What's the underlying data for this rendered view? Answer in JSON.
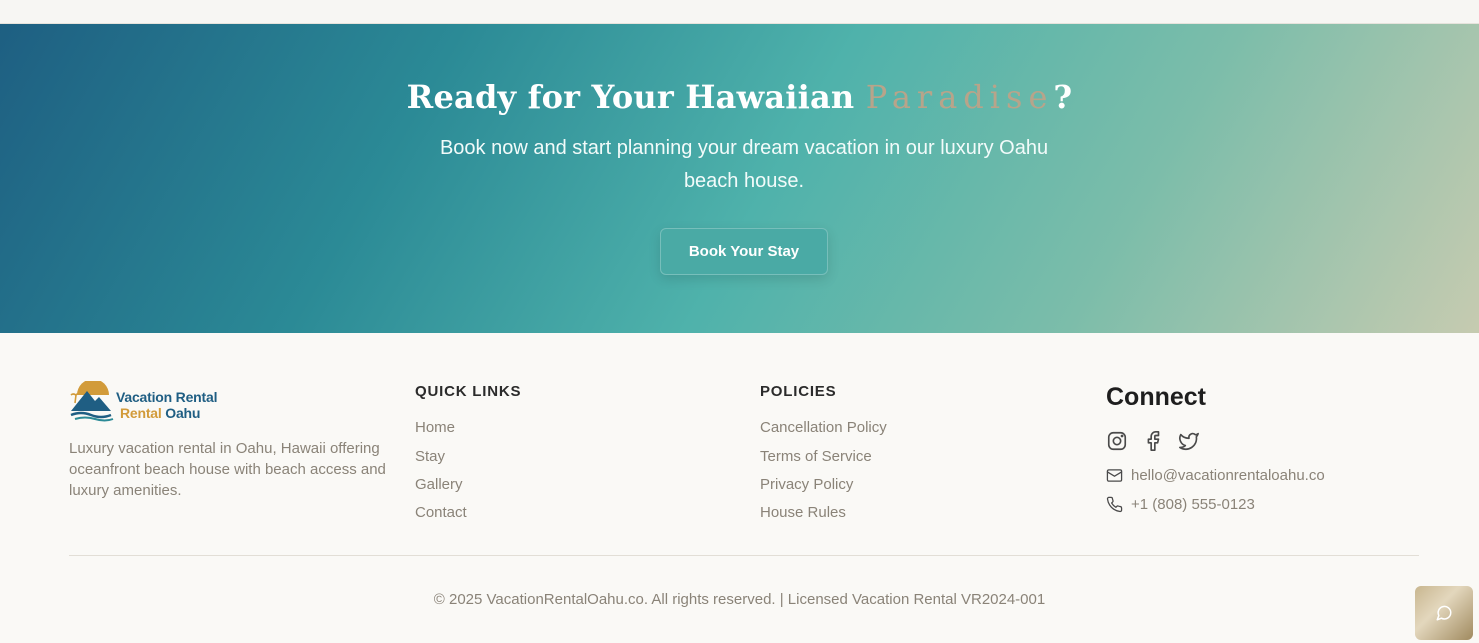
{
  "cta": {
    "title_main": "Ready for Your Hawaiian ",
    "title_accent": "Paradise",
    "title_end": "?",
    "subtitle": "Book now and start planning your dream vacation in our luxury Oahu beach house.",
    "button_label": "Book Your Stay"
  },
  "brand": {
    "logo_line1": "Vacation Rental",
    "logo_line2a": "Rental ",
    "logo_line2b": "Oahu",
    "description": "Luxury vacation rental in Oahu, Hawaii offering oceanfront beach house with beach access and luxury amenities."
  },
  "quick_links": {
    "title": "QUICK LINKS",
    "items": [
      "Home",
      "Stay",
      "Gallery",
      "Contact"
    ]
  },
  "policies": {
    "title": "POLICIES",
    "items": [
      "Cancellation Policy",
      "Terms of Service",
      "Privacy Policy",
      "House Rules"
    ]
  },
  "connect": {
    "title": "Connect",
    "social_icons": [
      "instagram-icon",
      "facebook-icon",
      "twitter-icon"
    ],
    "email": "hello@vacationrentaloahu.co",
    "phone": "+1 (808) 555-0123"
  },
  "footer": {
    "copyright": "© 2025 VacationRentalOahu.co. All rights reserved. | Licensed Vacation Rental VR2024-001"
  },
  "colors": {
    "gradient_start": "#1e5f82",
    "gradient_mid": "#4fb2ab",
    "gradient_end": "#c6cbb0",
    "accent_gold": "#b8a48a",
    "muted_text": "#8a8378"
  },
  "chat": {
    "icon": "chat-bubble-icon"
  }
}
